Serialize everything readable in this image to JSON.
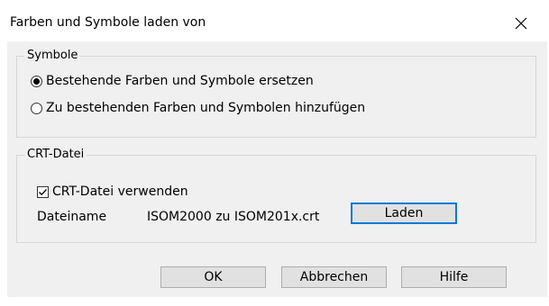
{
  "window": {
    "title": "Farben und Symbole laden von",
    "close_icon": "close-icon"
  },
  "symbole_group": {
    "legend": "Symbole",
    "options": [
      {
        "label": "Bestehende Farben und Symbole ersetzen",
        "checked": true
      },
      {
        "label": "Zu bestehenden Farben und Symbolen hinzufügen",
        "checked": false
      }
    ]
  },
  "crt_group": {
    "legend": "CRT-Datei",
    "use_crt_label": "CRT-Datei verwenden",
    "use_crt_checked": true,
    "filename_label": "Dateiname",
    "filename_value": "ISOM2000 zu ISOM201x.crt",
    "load_button": "Laden"
  },
  "buttons": {
    "ok": "OK",
    "cancel": "Abbrechen",
    "help": "Hilfe"
  },
  "colors": {
    "client_bg": "#f0f0f0",
    "button_bg": "#e1e1e1",
    "focus_border": "#0078d7"
  }
}
